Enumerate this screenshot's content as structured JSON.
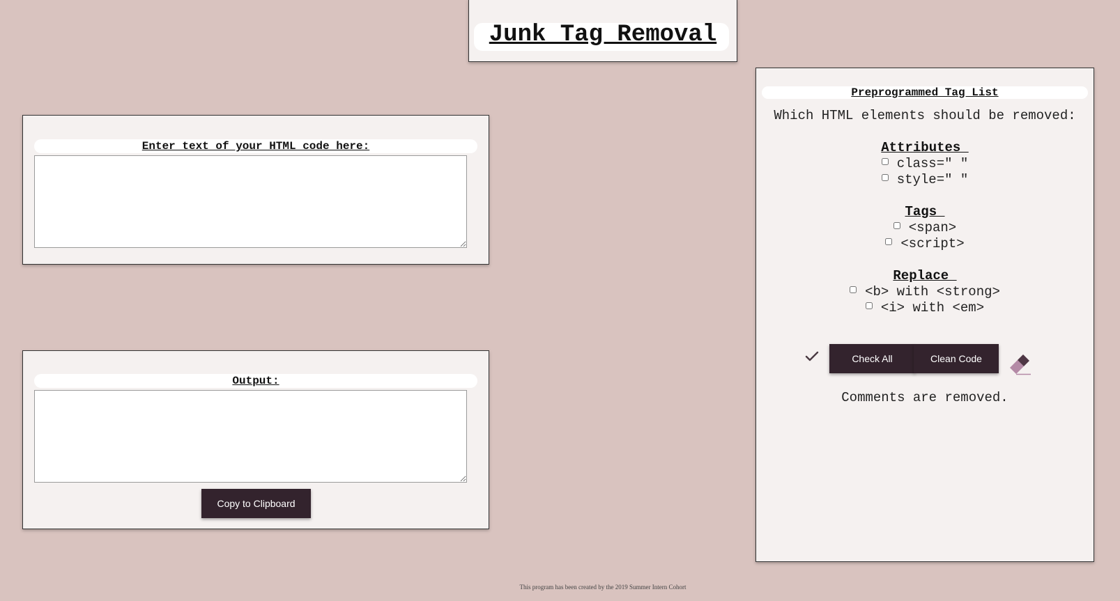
{
  "header": {
    "title": "Junk Tag Removal"
  },
  "input": {
    "label": "Enter text of your HTML code here:",
    "value": ""
  },
  "output": {
    "label": "Output:",
    "value": "",
    "copy_button_label": "Copy to Clipboard"
  },
  "options": {
    "panel_title": "Preprogrammed Tag List",
    "question": "Which HTML elements should be removed:",
    "sections": {
      "attributes": {
        "heading": "Attributes ",
        "items": [
          {
            "label": "class=\" \"",
            "checked": false
          },
          {
            "label": "style=\" \"",
            "checked": false
          }
        ]
      },
      "tags": {
        "heading": "Tags ",
        "items": [
          {
            "label": "<span>",
            "checked": false
          },
          {
            "label": "<script>",
            "checked": false
          }
        ]
      },
      "replace": {
        "heading": "Replace ",
        "items": [
          {
            "label": "<b> with <strong>",
            "checked": false
          },
          {
            "label": "<i> with <em>",
            "checked": false
          }
        ]
      }
    },
    "check_all_label": "Check All",
    "clean_code_label": "Clean Code",
    "check_icon": "check-icon",
    "eraser_icon": "eraser-icon",
    "note": "Comments are removed."
  },
  "footer": {
    "credit": "This program has been created by the 2019 Summer Intern Cohort"
  },
  "colors": {
    "background": "#d9c3bf",
    "panel": "#f5f1f0",
    "button": "#33232d",
    "button_text": "#ffffff",
    "eraser_accent": "#b48aa6"
  }
}
